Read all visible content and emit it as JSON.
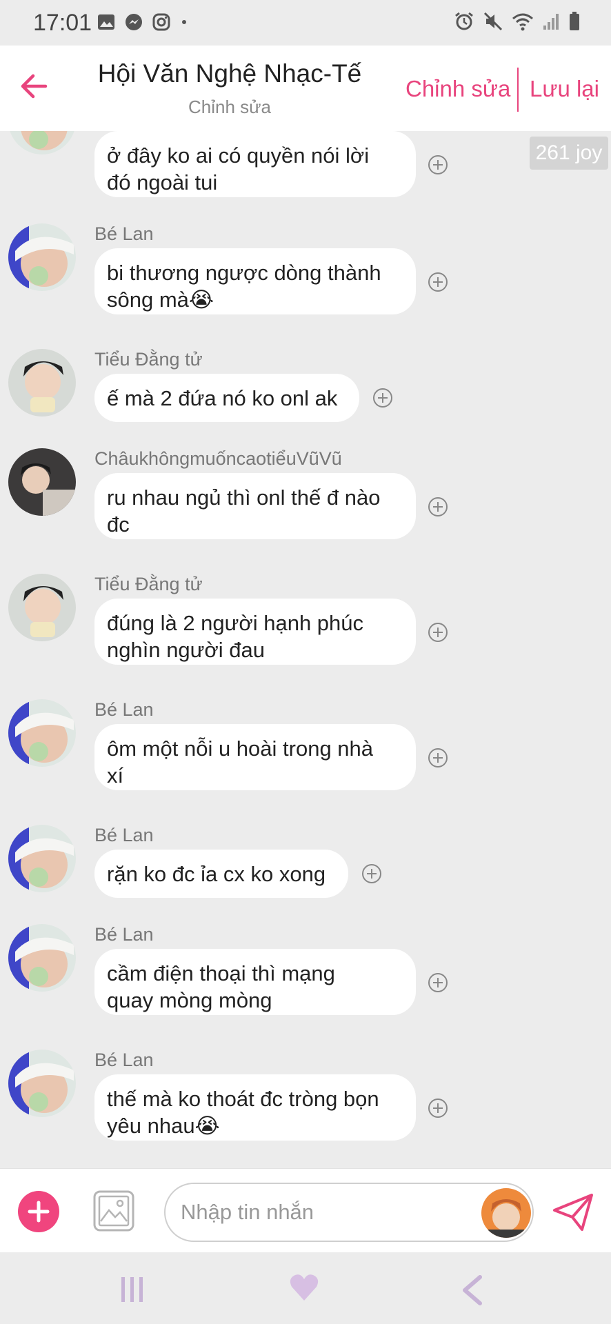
{
  "status_bar": {
    "time": "17:01"
  },
  "header": {
    "title": "Hội Văn Nghệ Nhạc-Tế",
    "subtitle": "Chỉnh sửa",
    "edit_label": "Chỉnh sửa",
    "save_label": "Lưu lại"
  },
  "joy_badge": "261 joy",
  "messages": [
    {
      "sender": "",
      "lines": [
        "ở đây ko ai có quyền nói lời",
        "đó ngoài tui"
      ],
      "avatar": "avatar-be-lan"
    },
    {
      "sender": "Bé Lan",
      "lines": [
        "bi thương ngược dòng thành",
        "sông mà😭"
      ],
      "avatar": "avatar-be-lan"
    },
    {
      "sender": "Tiểu Đằng tử",
      "lines": [
        "ế mà 2 đứa nó ko onl ak"
      ],
      "avatar": "avatar-tieu-dang-tu"
    },
    {
      "sender": "ChâukhôngmuốncaotiểuVũVũ",
      "lines": [
        "ru nhau ngủ thì onl thế đ nào",
        "đc"
      ],
      "avatar": "avatar-chau"
    },
    {
      "sender": "Tiểu Đằng tử",
      "lines": [
        "đúng là 2 người hạnh phúc",
        "nghìn người đau"
      ],
      "avatar": "avatar-tieu-dang-tu"
    },
    {
      "sender": "Bé Lan",
      "lines": [
        "ôm một nỗi u hoài trong nhà",
        "xí"
      ],
      "avatar": "avatar-be-lan"
    },
    {
      "sender": "Bé Lan",
      "lines": [
        "rặn ko đc ỉa cx ko xong"
      ],
      "avatar": "avatar-be-lan"
    },
    {
      "sender": "Bé Lan",
      "lines": [
        "cầm điện thoại thì mạng",
        "quay mòng mòng"
      ],
      "avatar": "avatar-be-lan"
    },
    {
      "sender": "Bé Lan",
      "lines": [
        "thế mà ko thoát đc tròng bọn",
        "yêu nhau😭"
      ],
      "avatar": "avatar-be-lan"
    }
  ],
  "input": {
    "placeholder": "Nhập tin nhắn",
    "value": ""
  },
  "colors": {
    "accent": "#e8447d",
    "background": "#ececec",
    "bubble": "#ffffff"
  }
}
